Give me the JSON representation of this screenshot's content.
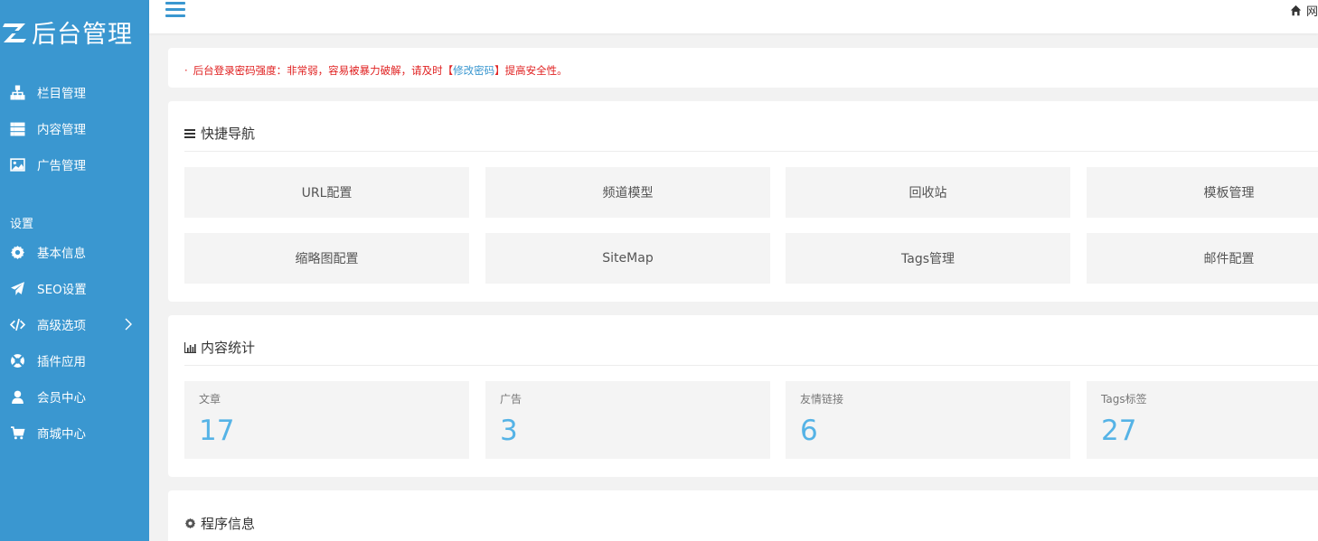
{
  "brand": {
    "name": "后台管理",
    "logo_letter": "Z"
  },
  "sidebar": {
    "items": [
      {
        "label": "栏目管理",
        "icon": "sitemap-icon"
      },
      {
        "label": "内容管理",
        "icon": "list-icon"
      },
      {
        "label": "广告管理",
        "icon": "image-icon"
      }
    ],
    "section_label": "设置",
    "settings_items": [
      {
        "label": "基本信息",
        "icon": "gear-icon"
      },
      {
        "label": "SEO设置",
        "icon": "paper-plane-icon"
      },
      {
        "label": "高级选项",
        "icon": "code-icon",
        "has_submenu": true
      },
      {
        "label": "插件应用",
        "icon": "support-icon"
      },
      {
        "label": "会员中心",
        "icon": "user-icon"
      },
      {
        "label": "商城中心",
        "icon": "cart-icon"
      }
    ]
  },
  "header": {
    "home_label": "网",
    "menu_icon": "hamburger-icon",
    "home_icon": "home-icon"
  },
  "alert": {
    "bullet": "·",
    "text_before": "后台登录密码强度：非常弱，容易被暴力破解，请及时",
    "bracket_open": "【",
    "link_text": "修改密码",
    "bracket_close": "】",
    "text_after": "提高安全性。",
    "color": "#e02020",
    "link_color": "#3a97d0"
  },
  "quick_nav": {
    "title": "快捷导航",
    "icon": "bars-icon",
    "tiles": [
      "URL配置",
      "频道模型",
      "回收站",
      "模板管理",
      "缩略图配置",
      "SiteMap",
      "Tags管理",
      "邮件配置"
    ]
  },
  "stats": {
    "title": "内容统计",
    "icon": "bar-chart-icon",
    "items": [
      {
        "label": "文章",
        "value": "17"
      },
      {
        "label": "广告",
        "value": "3"
      },
      {
        "label": "友情链接",
        "value": "6"
      },
      {
        "label": "Tags标签",
        "value": "27"
      }
    ],
    "value_color": "#55b3e6"
  },
  "program_info": {
    "title": "程序信息",
    "icon": "gear-icon"
  },
  "colors": {
    "sidebar": "#3a97d0",
    "background": "#f2f2f2",
    "accent": "#3a97d0"
  }
}
